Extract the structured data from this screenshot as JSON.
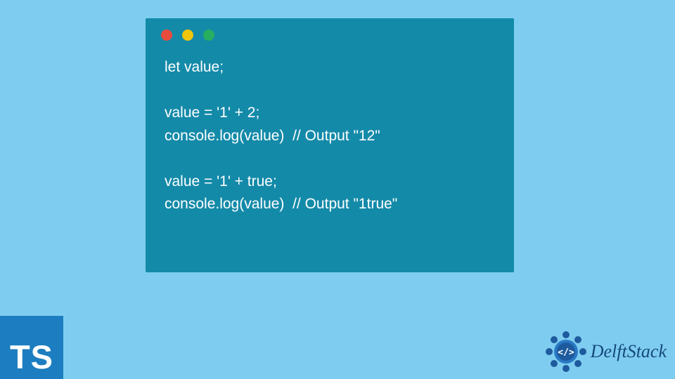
{
  "window": {
    "dots": [
      "red",
      "yellow",
      "green"
    ]
  },
  "code": {
    "line1": "let value;",
    "line2": "",
    "line3": "value = '1' + 2;",
    "line4": "console.log(value)  // Output \"12\"",
    "line5": "",
    "line6": "value = '1' + true;",
    "line7": "console.log(value)  // Output \"1true\""
  },
  "badges": {
    "ts_label": "TS",
    "delft_label": "DelftStack"
  },
  "colors": {
    "background": "#7ecdf0",
    "window_bg": "#148aa9",
    "code_text": "#ffffff",
    "ts_bg": "#1c7ec0",
    "delft_color": "#16497c"
  }
}
